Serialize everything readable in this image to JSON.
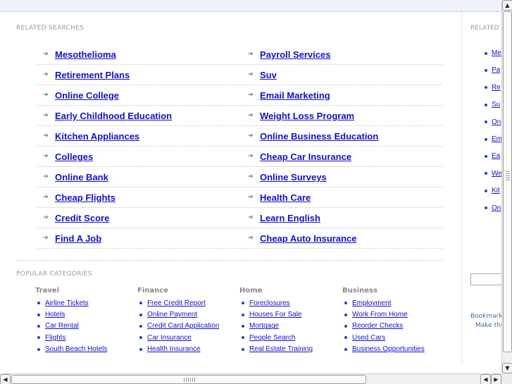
{
  "related_searches": {
    "title": "RELATED SEARCHES",
    "left": [
      "Mesothelioma",
      "Retirement Plans",
      "Online College",
      "Early Childhood Education",
      "Kitchen Appliances",
      "Colleges",
      "Online Bank",
      "Cheap Flights",
      "Credit Score",
      "Find A Job"
    ],
    "right": [
      "Payroll Services",
      "Suv",
      "Email Marketing",
      "Weight Loss Program",
      "Online Business Education",
      "Cheap Car Insurance",
      "Online Surveys",
      "Health Care",
      "Learn English",
      "Cheap Auto Insurance"
    ]
  },
  "popular_categories": {
    "title": "POPULAR CATEGORIES",
    "columns": [
      {
        "heading": "Travel",
        "items": [
          "Airline Tickets",
          "Hotels",
          "Car Rental",
          "Flights",
          "South Beach Hotels"
        ]
      },
      {
        "heading": "Finance",
        "items": [
          "Free Credit Report",
          "Online Payment",
          "Credit Card Application",
          "Car Insurance",
          "Health Insurance"
        ]
      },
      {
        "heading": "Home",
        "items": [
          "Foreclosures",
          "Houses For Sale",
          "Mortgage",
          "People Search",
          "Real Estate Training"
        ]
      },
      {
        "heading": "Business",
        "items": [
          "Employment",
          "Work From Home",
          "Reorder Checks",
          "Used Cars",
          "Business Opportunities"
        ]
      }
    ]
  },
  "sidebar": {
    "title": "RELATED",
    "items": [
      "Me",
      "Pa",
      "Re",
      "Su",
      "On",
      "Em",
      "Ea",
      "We",
      "Kit",
      "On"
    ],
    "bookmark_text": "Bookmark",
    "make_text": "Make thi"
  },
  "scrollbars": {
    "up": "▲",
    "down": "▼",
    "left": "◀",
    "right": "▶"
  },
  "colors": {
    "link": "#1111cc",
    "arrow": "#3d8f8a",
    "section_title": "#999999",
    "top_band": "#eef3fb"
  }
}
